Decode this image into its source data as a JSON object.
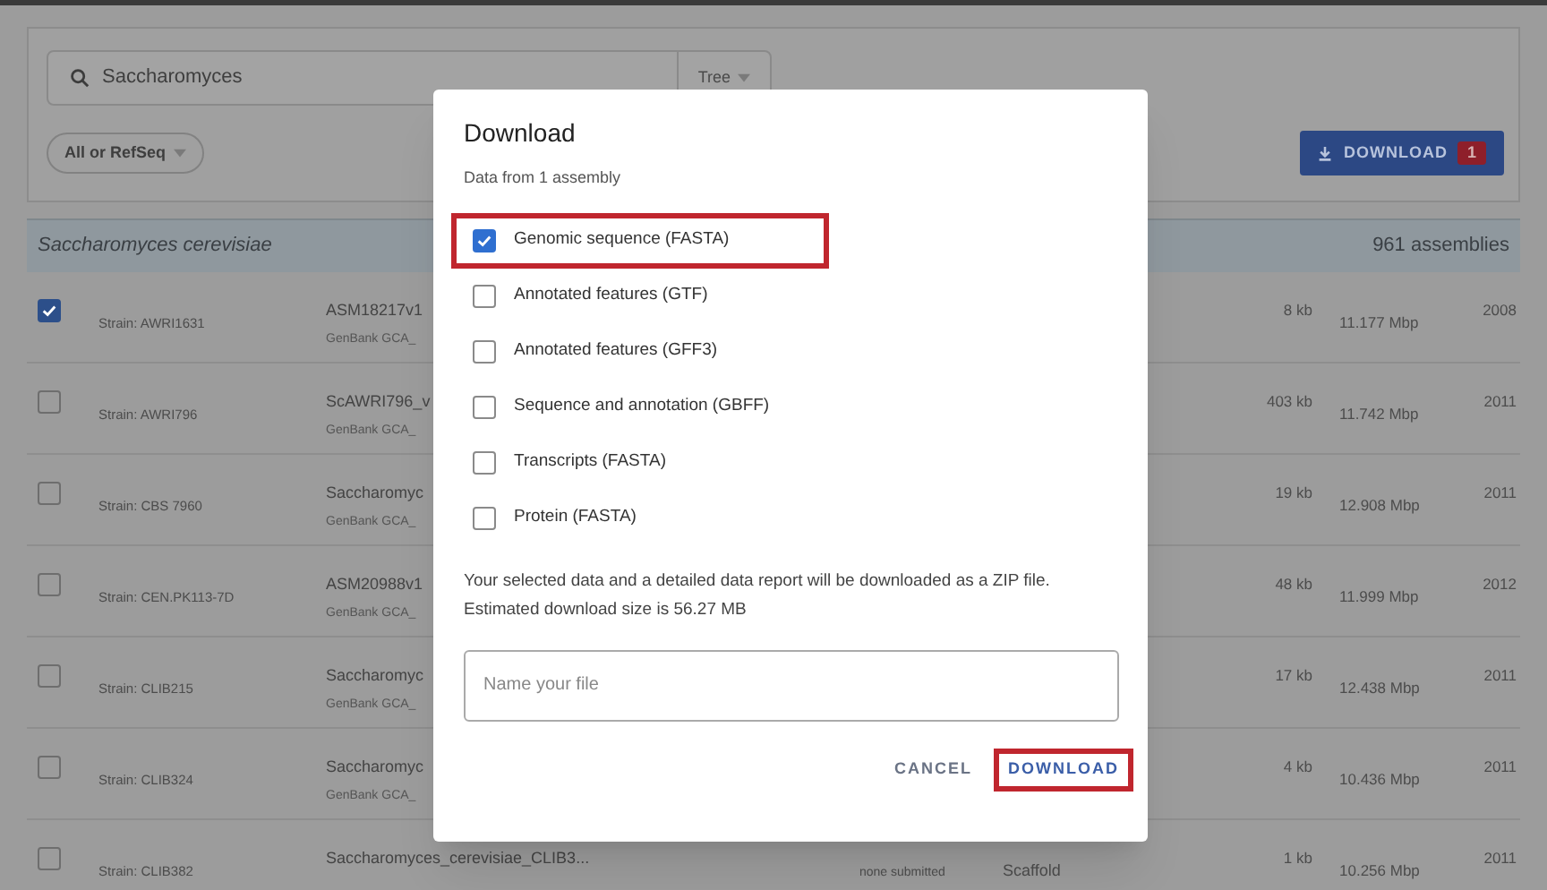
{
  "search": {
    "value": "Saccharomyces",
    "view_dropdown": "Tree"
  },
  "filter": {
    "label": "All or RefSeq"
  },
  "download_button": {
    "label": "DOWNLOAD",
    "badge": "1"
  },
  "group": {
    "title": "Saccharomyces cerevisiae",
    "count": "961 assemblies"
  },
  "rows": [
    {
      "checked": true,
      "strain": "Strain: AWRI1631",
      "name": "ASM18217v1",
      "accession": "GenBank GCA_",
      "size": "8 kb",
      "length": "11.177 Mbp",
      "year": "2008"
    },
    {
      "checked": false,
      "strain": "Strain: AWRI796",
      "name": "ScAWRI796_v",
      "accession": "GenBank GCA_",
      "size": "403 kb",
      "length": "11.742 Mbp",
      "year": "2011"
    },
    {
      "checked": false,
      "strain": "Strain: CBS 7960",
      "name": "Saccharomyc",
      "accession": "GenBank GCA_",
      "size": "19 kb",
      "length": "12.908 Mbp",
      "year": "2011"
    },
    {
      "checked": false,
      "strain": "Strain: CEN.PK113-7D",
      "name": "ASM20988v1",
      "accession": "GenBank GCA_",
      "size": "48 kb",
      "length": "11.999 Mbp",
      "year": "2012"
    },
    {
      "checked": false,
      "strain": "Strain: CLIB215",
      "name": "Saccharomyc",
      "accession": "GenBank GCA_",
      "size": "17 kb",
      "length": "12.438 Mbp",
      "year": "2011"
    },
    {
      "checked": false,
      "strain": "Strain: CLIB324",
      "name": "Saccharomyc",
      "accession": "GenBank GCA_",
      "size": "4 kb",
      "length": "10.436 Mbp",
      "year": "2011"
    },
    {
      "checked": false,
      "strain": "Strain: CLIB382",
      "name": "Saccharomyces_cerevisiae_CLIB3...",
      "submitter": "none submitted",
      "level": "Scaffold",
      "size": "1 kb",
      "length": "10.256 Mbp",
      "year": "2011"
    }
  ],
  "dialog": {
    "title": "Download",
    "subtitle": "Data from 1 assembly",
    "options": [
      {
        "label": "Genomic sequence (FASTA)",
        "checked": true,
        "highlighted": true
      },
      {
        "label": "Annotated features (GTF)",
        "checked": false,
        "highlighted": false
      },
      {
        "label": "Annotated features (GFF3)",
        "checked": false,
        "highlighted": false
      },
      {
        "label": "Sequence and annotation (GBFF)",
        "checked": false,
        "highlighted": false
      },
      {
        "label": "Transcripts (FASTA)",
        "checked": false,
        "highlighted": false
      },
      {
        "label": "Protein (FASTA)",
        "checked": false,
        "highlighted": false
      }
    ],
    "note": "Your selected data and a detailed data report will be downloaded as a ZIP file.",
    "estimate": "Estimated download size is 56.27 MB",
    "file_name": {
      "placeholder": "Name your file"
    },
    "buttons": [
      {
        "label": "CANCEL",
        "highlighted": false
      },
      {
        "label": "DOWNLOAD",
        "highlighted": true
      }
    ]
  }
}
